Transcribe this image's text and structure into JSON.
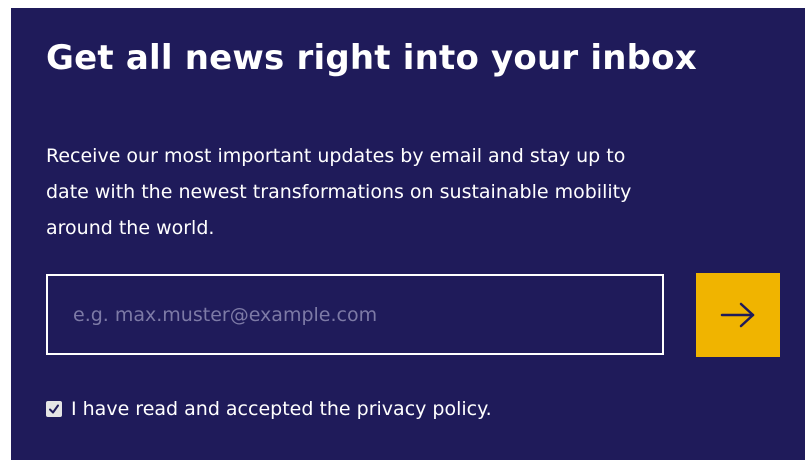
{
  "newsletter": {
    "title": "Get all news right into your inbox",
    "description": "Receive our most important updates by email and stay up to date with the newest transformations on sustainable mobility around the world.",
    "email_placeholder": "e.g. max.muster@example.com",
    "email_value": "",
    "submit_icon": "arrow-right-icon",
    "privacy_checked": true,
    "privacy_label": "I have read and accepted the privacy policy."
  },
  "colors": {
    "panel_background": "#1f1b5a",
    "accent": "#f0b400",
    "text": "#ffffff",
    "placeholder": "#7d7aa6"
  }
}
